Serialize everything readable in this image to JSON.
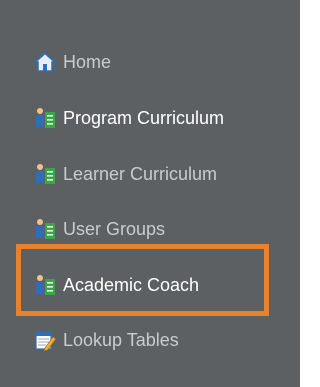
{
  "nav": {
    "items": [
      {
        "label": "Home",
        "icon": "home-icon",
        "state": "normal"
      },
      {
        "label": "Program Curriculum",
        "icon": "org-chart-icon",
        "state": "emphasized"
      },
      {
        "label": "Learner Curriculum",
        "icon": "org-chart-icon",
        "state": "normal"
      },
      {
        "label": "User Groups",
        "icon": "org-chart-icon",
        "state": "normal"
      },
      {
        "label": "Academic Coach",
        "icon": "org-chart-icon",
        "state": "emphasized"
      },
      {
        "label": "Lookup Tables",
        "icon": "edit-table-icon",
        "state": "normal"
      }
    ]
  },
  "colors": {
    "panel_bg": "#5d6063",
    "text_dim": "#c9cccf",
    "text_bright": "#ffffff",
    "highlight_border": "#e8822e"
  }
}
